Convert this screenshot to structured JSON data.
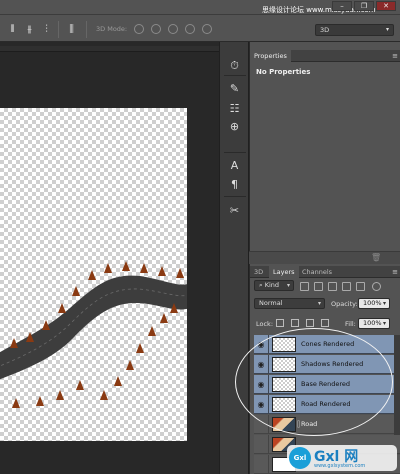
{
  "watermark_top": "思缘设计论坛 www.missyuan.com",
  "window_controls": [
    "–",
    "❐",
    "✕"
  ],
  "options_bar": {
    "mode_label": "3D Mode:",
    "workspace": "3D"
  },
  "icon_strip": [
    {
      "icon": "history-icon",
      "glyph": "⏱"
    },
    {
      "icon": "brush-icon",
      "glyph": "✎"
    },
    {
      "icon": "brush-presets-icon",
      "glyph": "☷"
    },
    {
      "icon": "clone-source-icon",
      "glyph": "⊕"
    },
    {
      "icon": "character-icon",
      "glyph": "A"
    },
    {
      "icon": "paragraph-icon",
      "glyph": "¶"
    },
    {
      "icon": "tools-icon",
      "glyph": "✂"
    }
  ],
  "properties_panel": {
    "tab": "Properties",
    "title": "No Properties"
  },
  "layers_panel": {
    "tabs": [
      "3D",
      "Layers",
      "Channels"
    ],
    "active_tab": "Layers",
    "filter_kind": "Kind",
    "blend_mode": "Normal",
    "opacity_label": "Opacity:",
    "opacity_value": "100%",
    "lock_label": "Lock:",
    "fill_label": "Fill:",
    "fill_value": "100%",
    "layers": [
      {
        "name": "Cones Rendered",
        "visible": true,
        "selected": true,
        "thumb": "checker"
      },
      {
        "name": "Shadows Rendered",
        "visible": true,
        "selected": true,
        "thumb": "checker"
      },
      {
        "name": "Base Rendered",
        "visible": true,
        "selected": true,
        "thumb": "checker"
      },
      {
        "name": "Road Rendered",
        "visible": true,
        "selected": true,
        "thumb": "checker"
      },
      {
        "name": "Road",
        "visible": false,
        "selected": false,
        "thumb": "photo"
      },
      {
        "name": "",
        "visible": false,
        "selected": false,
        "thumb": "photo"
      },
      {
        "name": "",
        "visible": false,
        "selected": false,
        "thumb": "white"
      }
    ]
  },
  "watermark_bottom": {
    "logo": "Gxl",
    "text": "Gxl 网",
    "sub": "www.gxlsystem.com"
  }
}
